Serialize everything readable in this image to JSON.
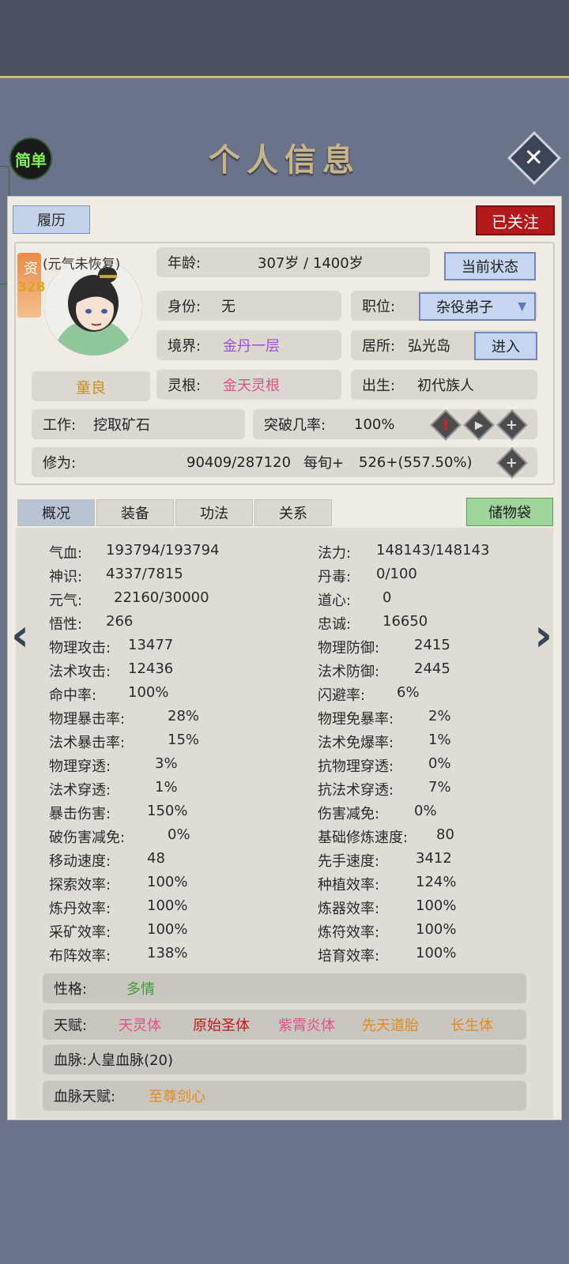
{
  "header": {
    "title": "个人信息",
    "simple_label": "简单",
    "close_icon": "close-x-icon"
  },
  "resume_tab": "履历",
  "follow_button": "已关注",
  "profile": {
    "zi_label": "资",
    "zi_value": "328",
    "qi_status": "(元气未恢复)",
    "name": "童良",
    "age_label": "年龄:",
    "age_value": "307岁 / 1400岁",
    "state_button": "当前状态",
    "identity_label": "身份:",
    "identity_value": "无",
    "position_label": "职位:",
    "position_value": "杂役弟子",
    "realm_label": "境界:",
    "realm_value": "金丹一层",
    "residence_label": "居所:",
    "residence_value": "弘光岛",
    "enter_button": "进入",
    "root_label": "灵根:",
    "root_value": "金天灵根",
    "birth_label": "出生:",
    "birth_value": "初代族人",
    "work_label": "工作:",
    "work_value": "挖取矿石",
    "breakthrough_label": "突破几率:",
    "breakthrough_value": "100%",
    "cultivation_label": "修为:",
    "cultivation_value": "90409/287120",
    "per_turn_label": "每旬+",
    "per_turn_value": "526+(557.50%)"
  },
  "tabs": [
    "概况",
    "装备",
    "功法",
    "关系"
  ],
  "storage_button": "储物袋",
  "stats_left": [
    {
      "label": "气血:",
      "value": "193794/193794"
    },
    {
      "label": "神识:",
      "value": "4337/7815"
    },
    {
      "label": "元气:",
      "value": "22160/30000"
    },
    {
      "label": "悟性:",
      "value": "266"
    },
    {
      "label": "物理攻击:",
      "value": "13477"
    },
    {
      "label": "法术攻击:",
      "value": "12436"
    },
    {
      "label": "命中率:",
      "value": "100%"
    },
    {
      "label": "物理暴击率:",
      "value": "28%"
    },
    {
      "label": "法术暴击率:",
      "value": "15%"
    },
    {
      "label": "物理穿透:",
      "value": "3%"
    },
    {
      "label": "法术穿透:",
      "value": "1%"
    },
    {
      "label": "暴击伤害:",
      "value": "150%"
    },
    {
      "label": "破伤害减免:",
      "value": "0%"
    },
    {
      "label": "移动速度:",
      "value": "48"
    },
    {
      "label": "探索效率:",
      "value": "100%"
    },
    {
      "label": "炼丹效率:",
      "value": "100%"
    },
    {
      "label": "采矿效率:",
      "value": "100%"
    },
    {
      "label": "布阵效率:",
      "value": "138%"
    }
  ],
  "stats_right": [
    {
      "label": "法力:",
      "value": "148143/148143"
    },
    {
      "label": "丹毒:",
      "value": "0/100"
    },
    {
      "label": "道心:",
      "value": "0"
    },
    {
      "label": "忠诚:",
      "value": "16650"
    },
    {
      "label": "物理防御:",
      "value": "2415"
    },
    {
      "label": "法术防御:",
      "value": "2445"
    },
    {
      "label": "闪避率:",
      "value": "6%"
    },
    {
      "label": "物理免暴率:",
      "value": "2%"
    },
    {
      "label": "法术免爆率:",
      "value": "1%"
    },
    {
      "label": "抗物理穿透:",
      "value": "0%"
    },
    {
      "label": "抗法术穿透:",
      "value": "7%"
    },
    {
      "label": "伤害减免:",
      "value": "0%"
    },
    {
      "label": "基础修炼速度:",
      "value": "80"
    },
    {
      "label": "先手速度:",
      "value": "3412"
    },
    {
      "label": "种植效率:",
      "value": "124%"
    },
    {
      "label": "炼器效率:",
      "value": "100%"
    },
    {
      "label": "炼符效率:",
      "value": "100%"
    },
    {
      "label": "培育效率:",
      "value": "100%"
    }
  ],
  "traits": {
    "personality_label": "性格:",
    "personality_value": "多情",
    "talent_label": "天赋:",
    "talents": [
      "天灵体",
      "原始圣体",
      "紫霄炎体",
      "先天道胎",
      "长生体"
    ],
    "bloodline_label": "血脉:",
    "bloodline_value": "人皇血脉(20)",
    "bloodline_talent_label": "血脉天赋:",
    "bloodline_talent_value": "至尊剑心"
  },
  "colors": {
    "realm": "#9b4fd0",
    "root": "#d9508a",
    "personality": "#3d9a3d",
    "name": "#c7901f",
    "talent_colors": [
      "#e0508a",
      "#c0181a",
      "#e0508a",
      "#e08a20",
      "#e08a20"
    ],
    "bloodline_talent": "#e08a20"
  }
}
